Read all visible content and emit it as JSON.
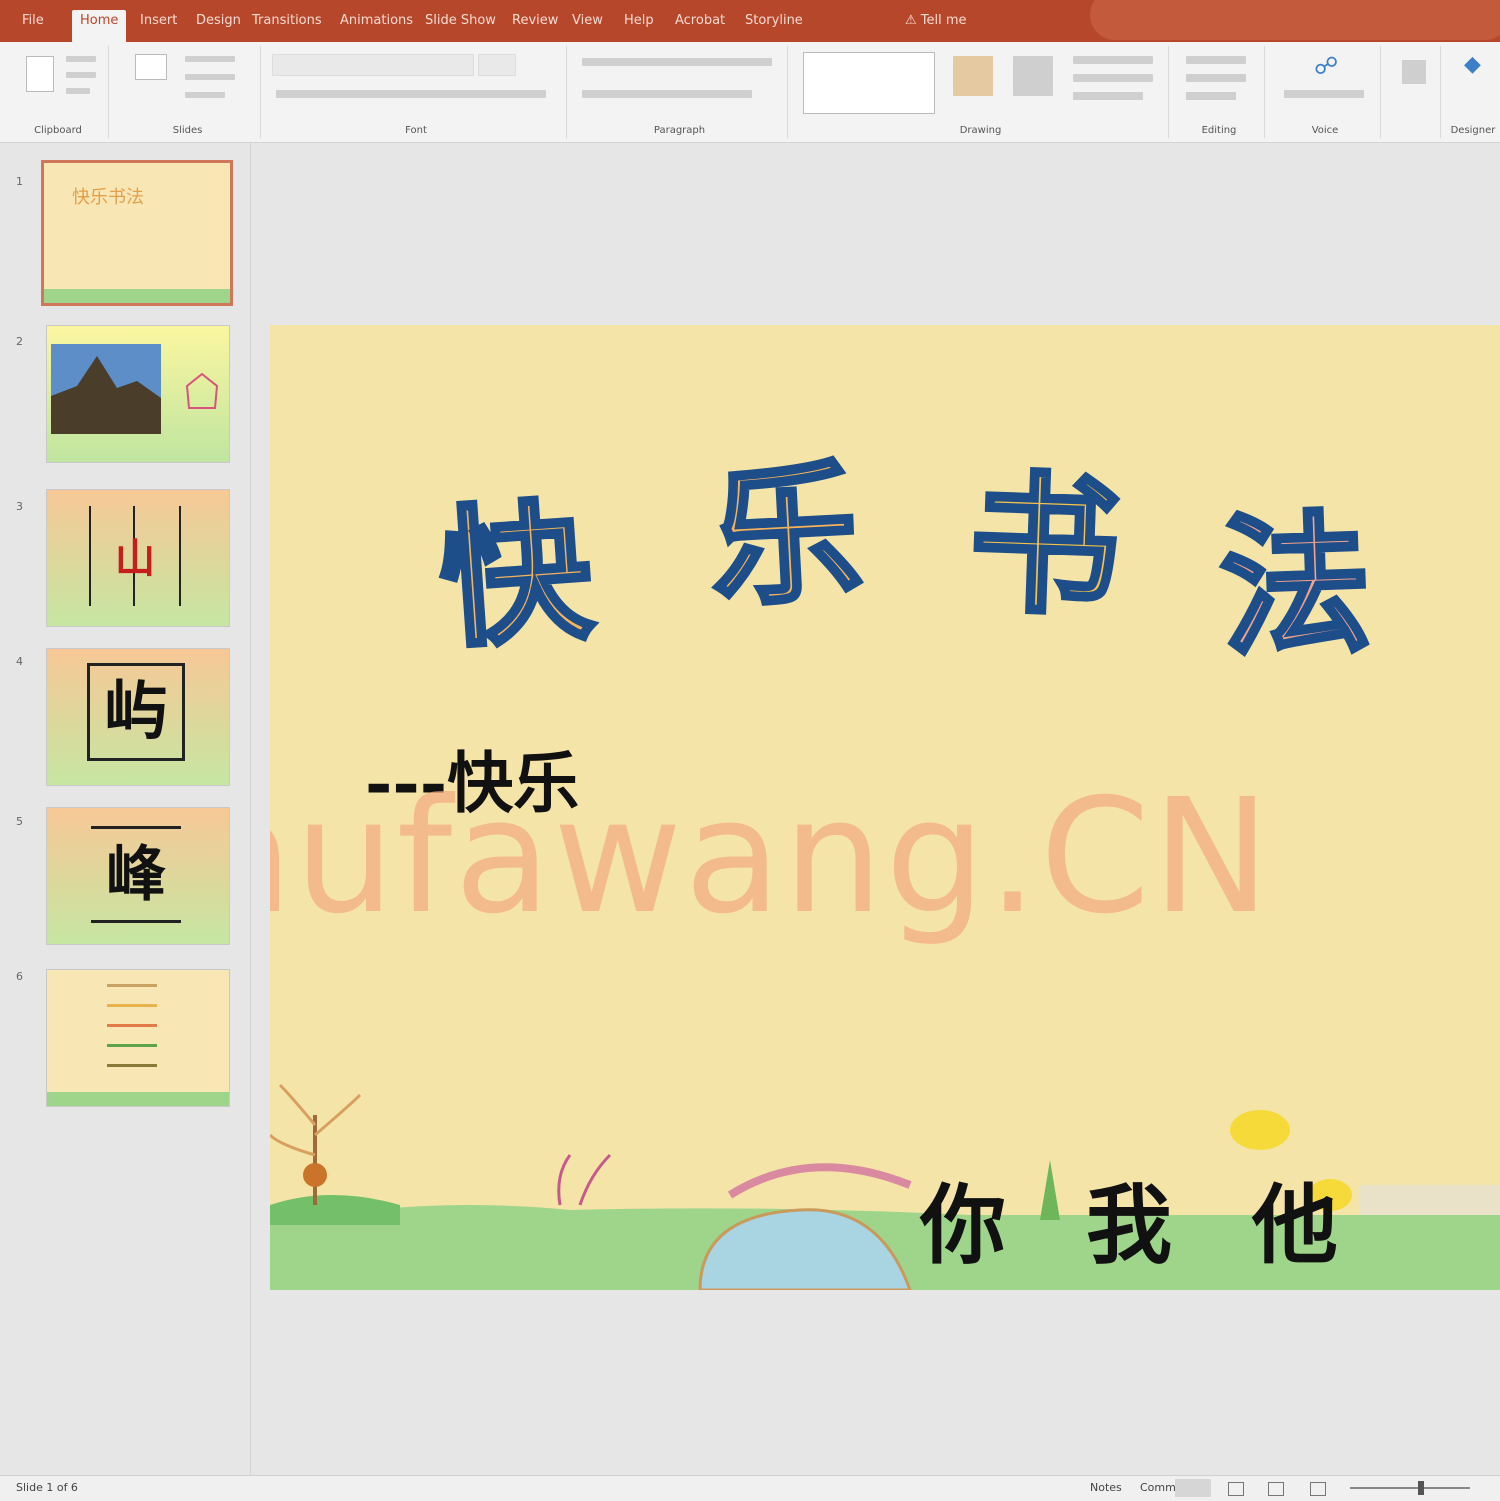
{
  "titlebar": {
    "tabs": [
      "File",
      "Home",
      "Insert",
      "Design",
      "Transitions",
      "Animations",
      "Slide Show",
      "Review",
      "View",
      "Help",
      "Acrobat",
      "Storyline",
      "Tell me"
    ],
    "active_tab_index": 1
  },
  "ribbon": {
    "groups": [
      "Clipboard",
      "Slides",
      "Font",
      "Paragraph",
      "Drawing",
      "Editing",
      "Voice",
      "Designer"
    ]
  },
  "slides_panel": {
    "numbers": [
      "1",
      "2",
      "3",
      "4",
      "5",
      "6"
    ],
    "selected_index": 0,
    "thumb3_char": "山",
    "thumb4_char": "屿",
    "thumb5_char": "峰"
  },
  "slide": {
    "title_chars": [
      "快",
      "乐",
      "书",
      "法"
    ],
    "subtitle_dash": "---",
    "subtitle": "快乐",
    "footer_chars": [
      "你",
      "我",
      "他"
    ],
    "watermark": "Shufawang.CN"
  },
  "colors": {
    "accent": "#b7472a",
    "slide_bg": "#f5e4a8",
    "title_fill_top": "#ffe23a",
    "title_fill_bottom": "#f4a28c",
    "title_stroke": "#1d4e89",
    "grass": "#9ed58a",
    "watermark": "#f2a57c"
  },
  "statusbar": {
    "left": "Slide 1 of 6",
    "notes": "Notes",
    "comments": "Comments"
  }
}
